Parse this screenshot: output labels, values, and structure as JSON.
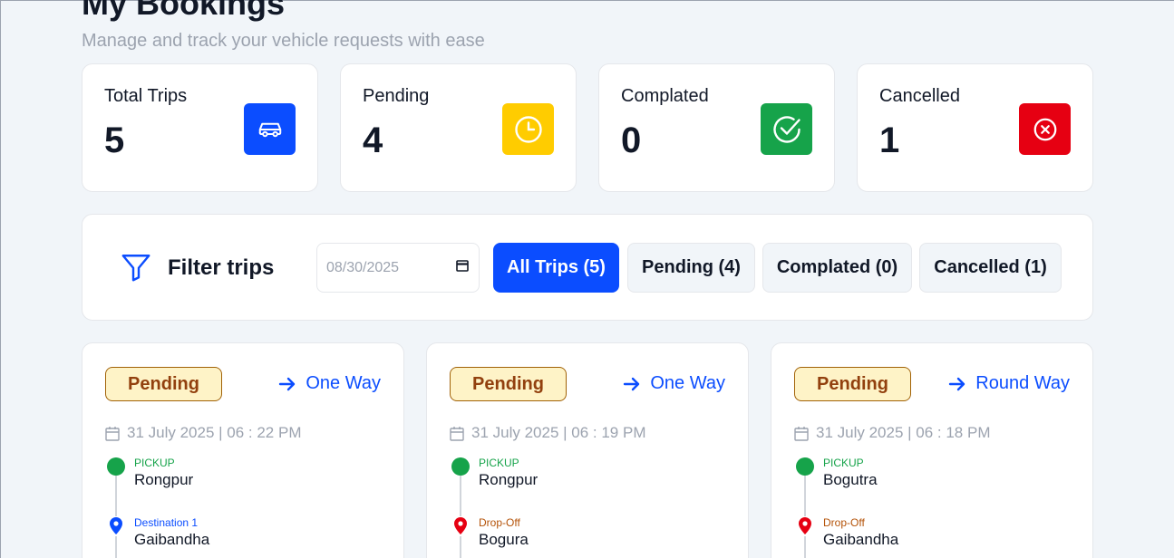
{
  "header": {
    "title": "My Bookings",
    "subtitle": "Manage and track your vehicle requests with ease"
  },
  "stats": [
    {
      "label": "Total Trips",
      "value": "5",
      "color": "#0b4dff",
      "icon": "car-icon"
    },
    {
      "label": "Pending",
      "value": "4",
      "color": "#ffcc00",
      "icon": "clock-icon"
    },
    {
      "label": "Complated",
      "value": "0",
      "color": "#16a34a",
      "icon": "check-circle-icon"
    },
    {
      "label": "Cancelled",
      "value": "1",
      "color": "#e60012",
      "icon": "x-circle-icon"
    }
  ],
  "filter": {
    "title": "Filter trips",
    "date_value": "08/30/2025",
    "buttons": [
      {
        "label": "All Trips (5)",
        "active": true
      },
      {
        "label": "Pending (4)",
        "active": false
      },
      {
        "label": "Complated (0)",
        "active": false
      },
      {
        "label": "Cancelled (1)",
        "active": false
      }
    ]
  },
  "trips": [
    {
      "status": "Pending",
      "type": "One Way",
      "datetime": "31 July 2025 | 06 : 22 PM",
      "pickup_label": "PICKUP",
      "pickup": "Rongpur",
      "drop_label": "Destination 1",
      "drop": "Gaibandha",
      "drop_color": "#0b4dff"
    },
    {
      "status": "Pending",
      "type": "One Way",
      "datetime": "31 July 2025 | 06 : 19 PM",
      "pickup_label": "PICKUP",
      "pickup": "Rongpur",
      "drop_label": "Drop-Off",
      "drop": "Bogura",
      "drop_color": "#b45309"
    },
    {
      "status": "Pending",
      "type": "Round Way",
      "datetime": "31 July 2025 | 06 : 18 PM",
      "pickup_label": "PICKUP",
      "pickup": "Bogutra",
      "drop_label": "Drop-Off",
      "drop": "Gaibandha",
      "drop_color": "#b45309"
    }
  ]
}
